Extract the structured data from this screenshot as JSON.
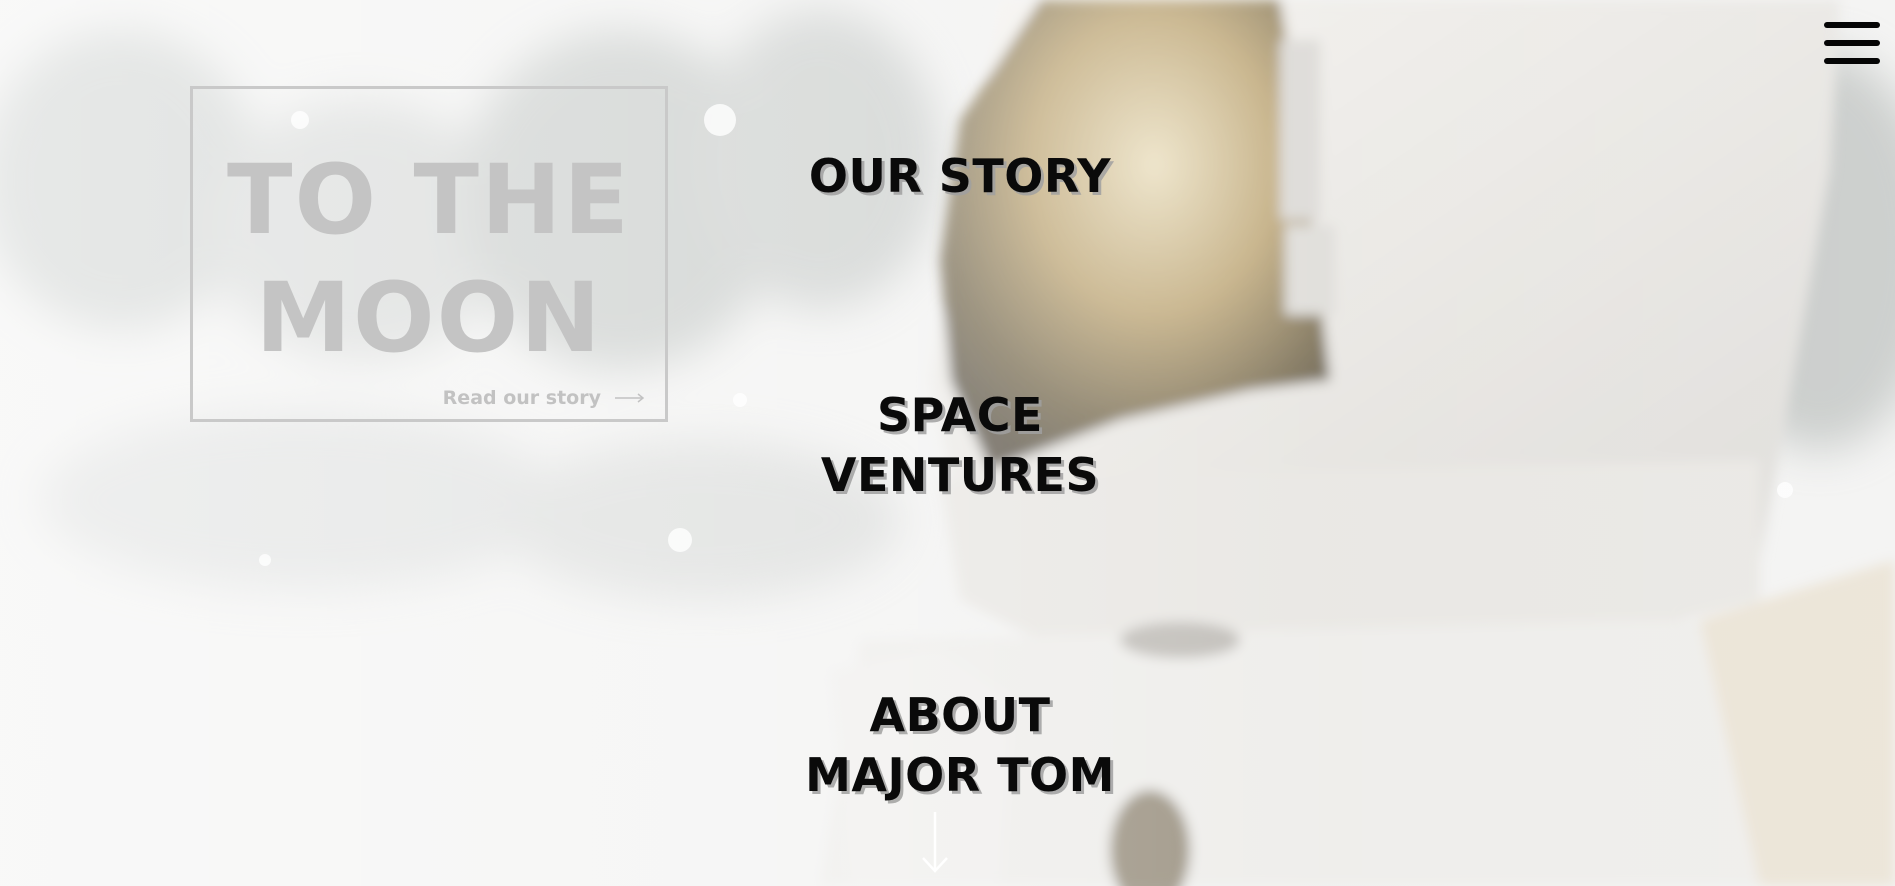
{
  "hero": {
    "title_line1": "TO THE",
    "title_line2": "MOON",
    "link_label": "Read our story"
  },
  "nav": {
    "items": [
      {
        "line1": "OUR STORY",
        "line2": ""
      },
      {
        "line1": "SPACE",
        "line2": "VENTURES"
      },
      {
        "line1": "ABOUT",
        "line2": "MAJOR TOM"
      }
    ]
  },
  "icons": {
    "menu": "hamburger-menu-icon",
    "read_arrow": "arrow-right-icon",
    "scroll": "arrow-down-icon"
  },
  "colors": {
    "hero_text": "#c4c4c4",
    "nav_text": "#0a0a0a",
    "nav_shadow": "#a0a0a0",
    "menu_icon": "#050505"
  }
}
